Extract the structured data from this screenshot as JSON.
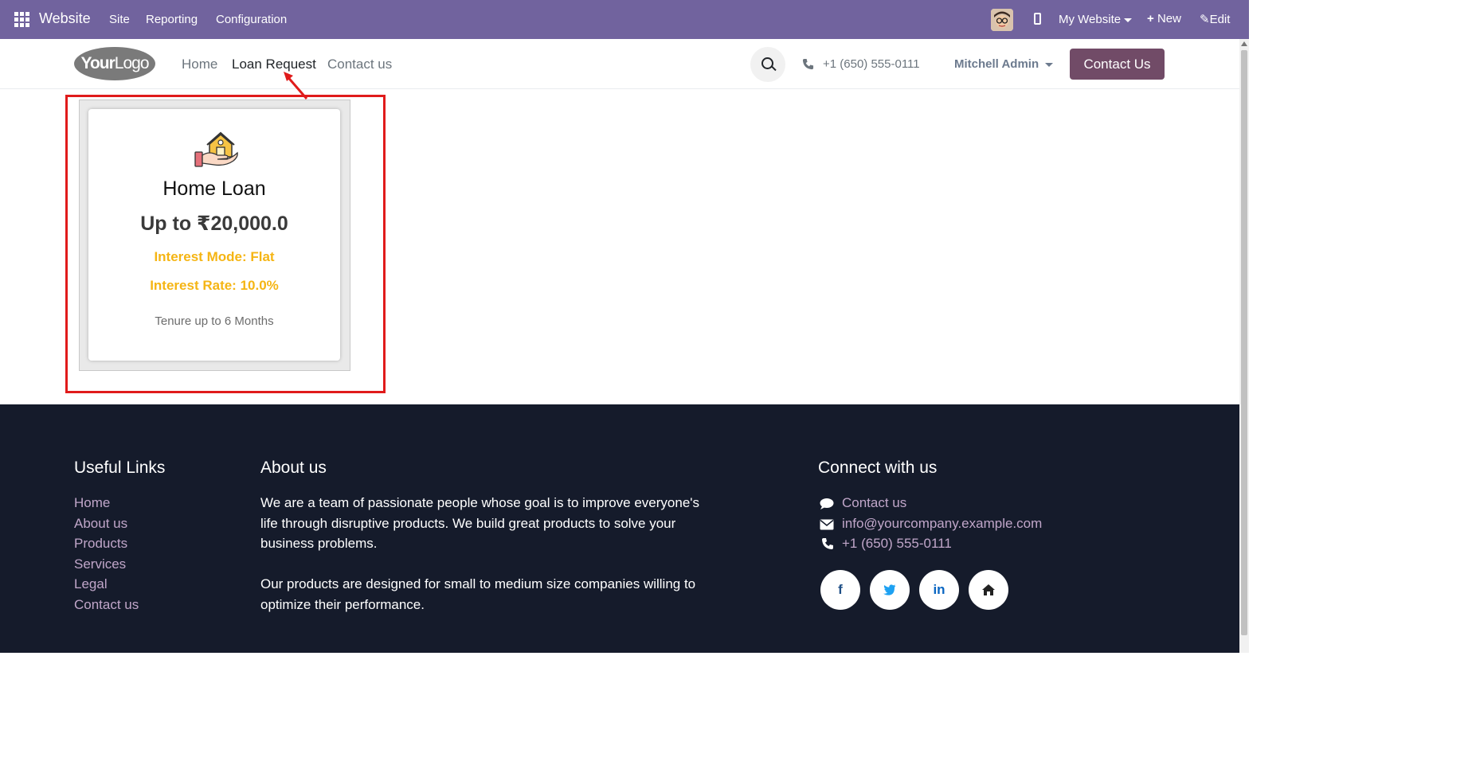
{
  "admin_bar": {
    "brand": "Website",
    "menu": [
      "Site",
      "Reporting",
      "Configuration"
    ],
    "website_selector": "My Website",
    "new_label": "New",
    "edit_label": "Edit"
  },
  "header": {
    "logo_bold": "Your",
    "logo_light": "Logo",
    "nav": [
      "Home",
      "Loan Request",
      "Contact us"
    ],
    "phone": "+1 (650) 555-0111",
    "user": "Mitchell Admin",
    "contact_button": "Contact Us"
  },
  "loan_card": {
    "title": "Home Loan",
    "amount": "Up to ₹20,000.0",
    "interest_mode": "Interest Mode: Flat",
    "interest_rate": "Interest Rate: 10.0%",
    "tenure": "Tenure up to 6 Months"
  },
  "footer": {
    "useful_links": {
      "heading": "Useful Links",
      "links": [
        "Home",
        "About us",
        "Products",
        "Services",
        "Legal",
        "Contact us"
      ]
    },
    "about": {
      "heading": "About us",
      "paragraph1": "We are a team of passionate people whose goal is to improve everyone's life through disruptive products. We build great products to solve your business problems.",
      "paragraph2": "Our products are designed for small to medium size companies willing to optimize their performance."
    },
    "connect": {
      "heading": "Connect with us",
      "contact": "Contact us",
      "email": "info@yourcompany.example.com",
      "phone": "+1 (650) 555-0111",
      "socials": [
        "f",
        "t",
        "in",
        "home"
      ]
    }
  },
  "colors": {
    "admin_bar": "#71639e",
    "primary": "#714b67",
    "footer_bg": "#151b2b",
    "footer_link": "#c0a6c9",
    "highlight": "#e01b1b",
    "accent_yellow": "#f5b514"
  }
}
